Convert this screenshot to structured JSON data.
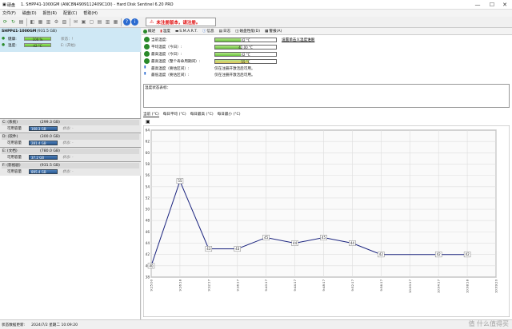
{
  "window": {
    "app_label": "硬盘",
    "title": "1. SHPP41-1000GM (ANC8N4909112409C10I) - Hard Disk Sentinel 6.20 PRO",
    "minimize": "—",
    "maximize": "☐",
    "close": "✕"
  },
  "menu": [
    "文件(F)",
    "磁盘(D)",
    "报告(R)",
    "配置(C)",
    "帮助(H)"
  ],
  "toolbar": {
    "alert_text": "未注册版本，请注册。",
    "alert_icon": "warning-icon"
  },
  "disk": {
    "name": "SHPP41-1000GM",
    "size": "(931.5 GB)",
    "health_label": "健康:",
    "health_value": "100 %",
    "health_pct": 100,
    "health_extra": "状态：!",
    "temp_label": "温度:",
    "temp_value": "42 °C",
    "temp_pct": 42,
    "temp_extra": "E: (开始)"
  },
  "partitions": [
    {
      "drive": "C: (系统)",
      "size": "(299.3 GB)",
      "free_label": "可用容量",
      "free_value": "168.3 GB",
      "z": "状态: -"
    },
    {
      "drive": "D: (软件)",
      "size": "(300.0 GB)",
      "free_label": "可用容量",
      "free_value": "281.4 GB",
      "z": "状态: -"
    },
    {
      "drive": "E: (文档)",
      "size": "(780.0 GB)",
      "free_label": "可用容量",
      "free_value": "37.2 GB",
      "z": "状态: -"
    },
    {
      "drive": "F: (影视剧)",
      "size": "(931.5 GB)",
      "free_label": "可用容量",
      "free_value": "895.4 GB",
      "z": "状态: -"
    }
  ],
  "tabs": [
    "概述",
    "温度",
    "S.M.A.R.T.",
    "信息",
    "日志",
    "磁盘性能(D)",
    "警报(A)"
  ],
  "temperature": {
    "rows": [
      {
        "label": "当前温度:",
        "value": "42 °C",
        "pct": 42,
        "orange": false
      },
      {
        "label": "平均温度（今日）:",
        "value": "42.00 °C",
        "pct": 42,
        "orange": false
      },
      {
        "label": "最高温度（今日）:",
        "value": "42 °C",
        "pct": 42,
        "orange": false
      },
      {
        "label": "最高温度（整个寿命周期间）:",
        "value": "55 °C",
        "pct": 55,
        "orange": true
      },
      {
        "label": "最高温度（要估区间）:",
        "value": "仅在注册开激活后可用。"
      },
      {
        "label": "最低温度（要估区间）:",
        "value": "仅在注册开激活后可用。"
      }
    ],
    "link": "设置单击义温度谁眼",
    "notes_label": "温度状态表标："
  },
  "chart_tabs": [
    "当前 (°C)",
    "每日平均 (°C)",
    "每日最高 (°C)",
    "每日最小 (°C)"
  ],
  "chart_data": {
    "type": "line",
    "x": [
      "9:25:00",
      "9:26:18",
      "9:32:17",
      "9:36:17",
      "9:40:17",
      "9:44:17",
      "9:48:17",
      "9:52:17",
      "9:56:17",
      "10:00:17",
      "10:04:17",
      "10:08:18",
      "10:09:20"
    ],
    "series": [
      {
        "values": [
          40,
          55,
          43,
          43,
          45,
          44,
          45,
          44,
          42,
          42,
          42
        ]
      }
    ],
    "point_x": [
      0,
      1,
      2,
      3,
      4,
      5,
      6,
      7,
      8,
      10,
      11
    ],
    "point_labels": [
      "40",
      "55",
      "43",
      "43",
      "45",
      "44",
      "45",
      "44",
      "42",
      "42",
      "42"
    ],
    "ylim": [
      38,
      64
    ],
    "yticks": [
      38,
      40,
      42,
      44,
      46,
      48,
      50,
      52,
      54,
      56,
      58,
      60,
      62,
      64
    ],
    "grid": true,
    "line_color": "#1a237e"
  },
  "status": {
    "label": "状态数据更新:",
    "datetime": "2024/7/2 星期二 10:09:20",
    "watermark": "值 什么值得买"
  }
}
